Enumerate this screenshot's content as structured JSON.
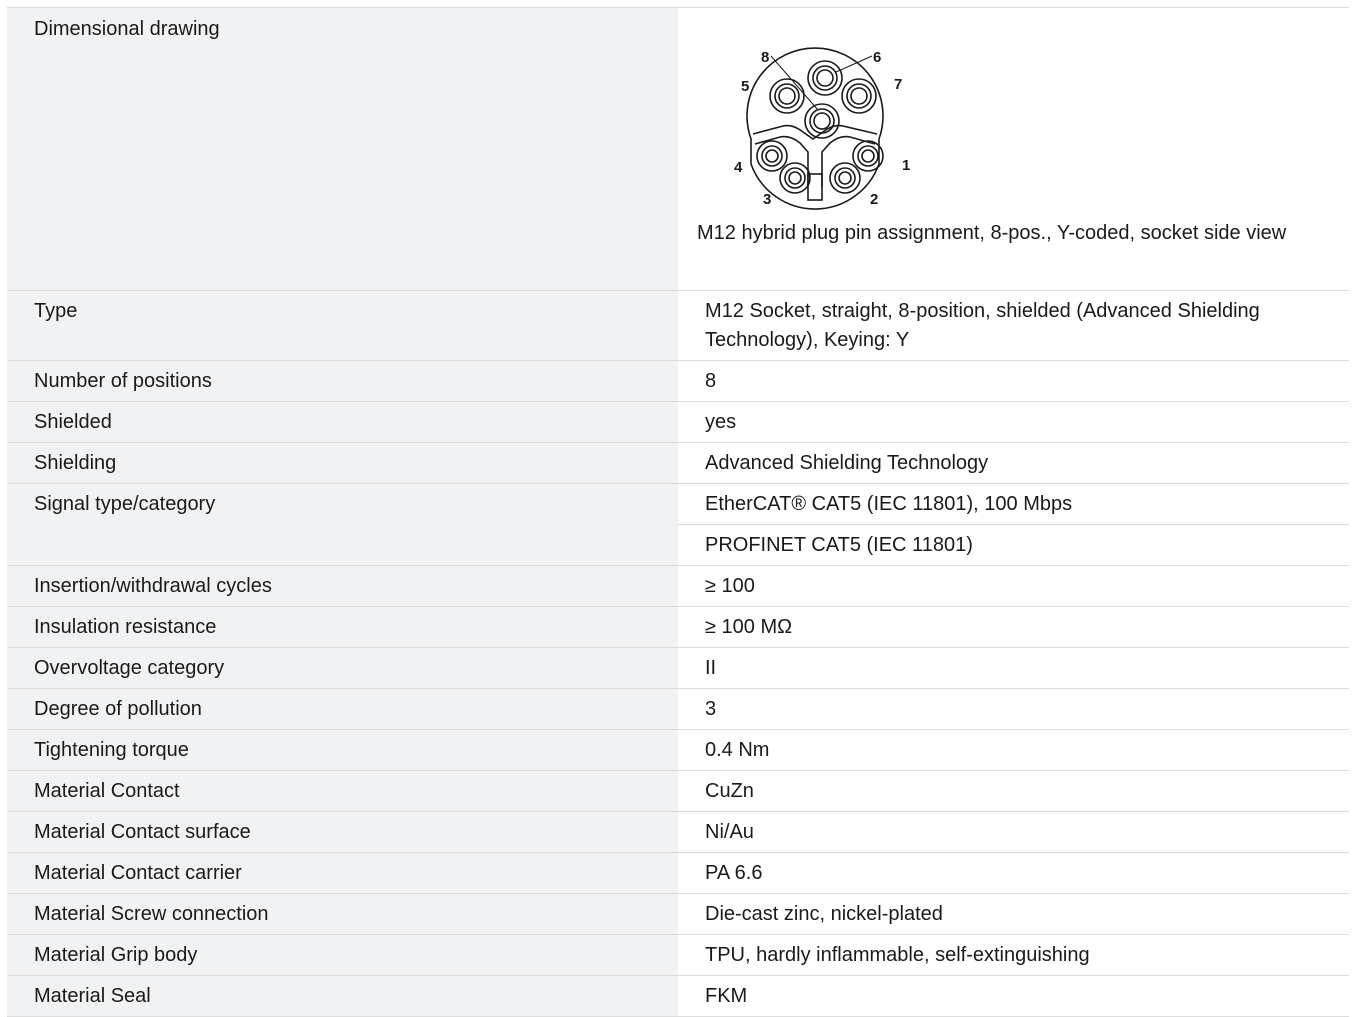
{
  "drawing": {
    "label": "Dimensional drawing",
    "caption": "M12 hybrid plug pin assignment, 8-pos., Y-coded, socket side view",
    "pins": [
      "1",
      "2",
      "3",
      "4",
      "5",
      "6",
      "7",
      "8"
    ]
  },
  "rows": [
    {
      "label": "Type",
      "value": "M12 Socket, straight, 8-position, shielded (Advanced Shielding Technology), Keying: Y"
    },
    {
      "label": "Number of positions",
      "value": "8"
    },
    {
      "label": "Shielded",
      "value": "yes"
    },
    {
      "label": "Shielding",
      "value": "Advanced Shielding Technology"
    },
    {
      "label": "Signal type/category",
      "value": "EtherCAT® CAT5 (IEC 11801), 100 Mbps"
    },
    {
      "label": "",
      "value": "PROFINET CAT5 (IEC 11801)"
    },
    {
      "label": "Insertion/withdrawal cycles",
      "value": "≥ 100"
    },
    {
      "label": "Insulation resistance",
      "value": "≥ 100 MΩ"
    },
    {
      "label": "Overvoltage category",
      "value": "II"
    },
    {
      "label": "Degree of pollution",
      "value": "3"
    },
    {
      "label": "Tightening torque",
      "value": "0.4 Nm"
    },
    {
      "label": "Material Contact",
      "value": "CuZn"
    },
    {
      "label": "Material Contact surface",
      "value": "Ni/Au"
    },
    {
      "label": "Material Contact carrier",
      "value": "PA 6.6"
    },
    {
      "label": "Material Screw connection",
      "value": "Die-cast zinc, nickel-plated"
    },
    {
      "label": "Material Grip body",
      "value": "TPU, hardly inflammable, self-extinguishing"
    },
    {
      "label": "Material Seal",
      "value": "FKM"
    }
  ]
}
